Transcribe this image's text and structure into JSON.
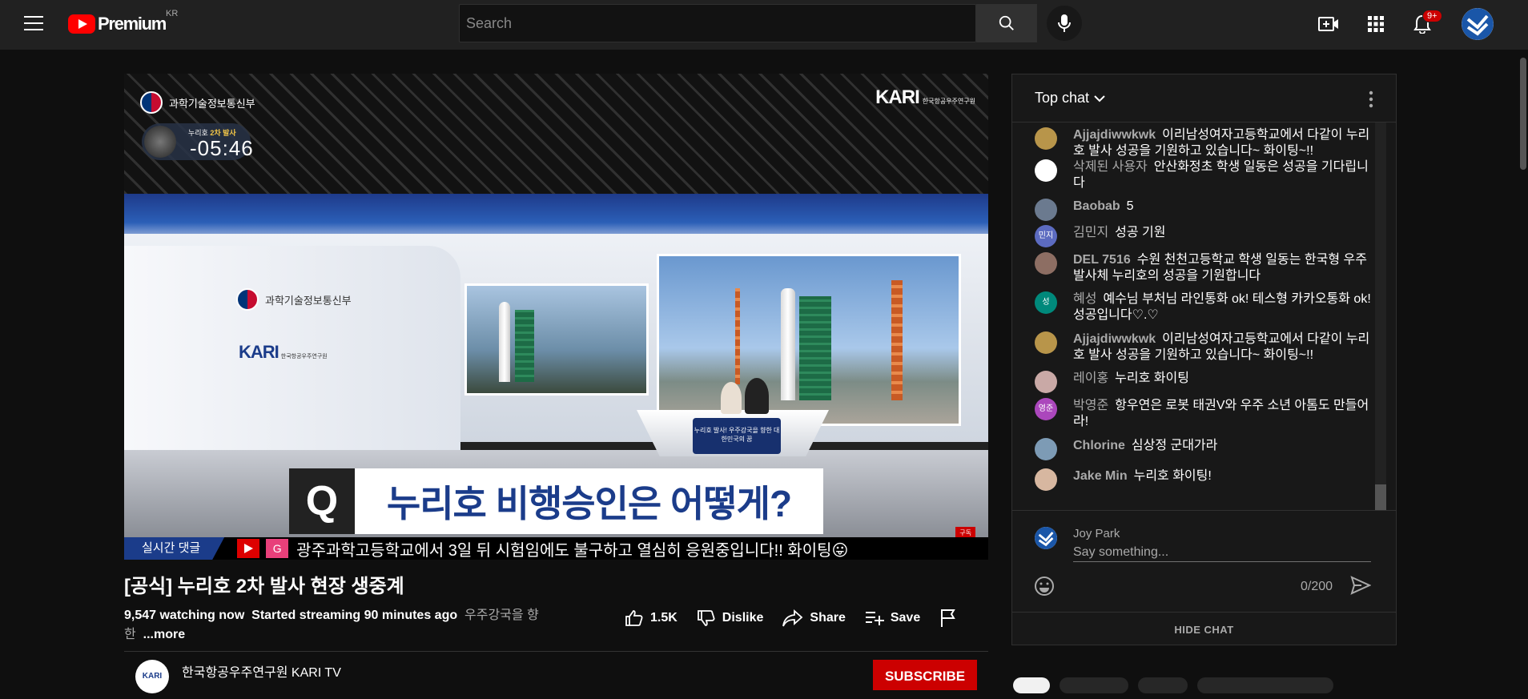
{
  "header": {
    "logo_text": "Premium",
    "region": "KR",
    "search_placeholder": "Search",
    "notification_count": "9+"
  },
  "video": {
    "ministry": "과학기술정보통신부",
    "org_logo": "KARI",
    "org_sub": "한국항공우주연구원",
    "countdown_label_prefix": "누리호",
    "countdown_label_highlight": "2차 발사",
    "countdown_time": "-05:46",
    "question_mark": "Q",
    "question_text": "누리호 비행승인은 어떻게?",
    "ticker_label": "실시간 댓글",
    "ticker_g": "G",
    "ticker_text": "광주과학고등학교에서 3일 뒤 시험임에도 불구하고 열심히 응원중입니다!! 화이팅😛",
    "subscribe_badge": "구독",
    "desk_text": "누리호 발사! 우주강국을 향한 대한민국의 꿈"
  },
  "info": {
    "title": "[공식] 누리호 2차 발사 현장 생중계",
    "watching": "9,547 watching now",
    "started": "Started streaming 90 minutes ago",
    "tags": "우주강국을 향한",
    "more": "...more",
    "likes": "1.5K",
    "dislike": "Dislike",
    "share": "Share",
    "save": "Save",
    "channel": "한국항공우주연구원 KARI TV",
    "channel_avatar": "KARI",
    "subscribe": "SUBSCRIBE"
  },
  "chat": {
    "title": "Top chat",
    "messages": [
      {
        "name": "Ajjajdiwwkwk",
        "text": "이리남성여자고등학교에서 다같이 누리호 발사 성공을 기원하고 있습니다~ 화이팅~!!",
        "avatar": "",
        "color": "#b8954a",
        "bold": true
      },
      {
        "name": "삭제된 사용자",
        "text": "안산화정초 학생 일동은 성공을 기다립니다",
        "avatar": "",
        "color": "#ffffff",
        "bold": false
      },
      {
        "name": "Baobab",
        "text": "5",
        "avatar": "",
        "color": "#6b7a8f",
        "bold": true
      },
      {
        "name": "김민지",
        "text": "성공 기원",
        "avatar": "민지",
        "color": "#5c6bc0",
        "bold": false
      },
      {
        "name": "DEL 7516",
        "text": "수원 천천고등학교 학생 일동는 한국형 우주발사체 누리호의 성공을 기원합니다",
        "avatar": "",
        "color": "#8d6e63",
        "bold": true
      },
      {
        "name": "혜성",
        "text": "예수님 부처님 라인통화 ok! 테스형 카카오통화 ok! 성공입니다♡.♡",
        "avatar": "성",
        "color": "#00897b",
        "bold": false
      },
      {
        "name": "Ajjajdiwwkwk",
        "text": "이리남성여자고등학교에서 다같이 누리호 발사 성공을 기원하고 있습니다~ 화이팅~!!",
        "avatar": "",
        "color": "#b8954a",
        "bold": true
      },
      {
        "name": "레이홍",
        "text": "누리호 화이팅",
        "avatar": "",
        "color": "#c9a9a6",
        "bold": false
      },
      {
        "name": "박영준",
        "text": "항우연은 로봇 태권V와 우주 소년 아톰도 만들어라!",
        "avatar": "영준",
        "color": "#ab47bc",
        "bold": false
      },
      {
        "name": "Chlorine",
        "text": "심상정 군대가라",
        "avatar": "",
        "color": "#7d9bb5",
        "bold": true
      },
      {
        "name": "Jake Min",
        "text": "누리호 화이팅!",
        "avatar": "",
        "color": "#d7b7a0",
        "bold": true
      }
    ],
    "user_name": "Joy Park",
    "input_placeholder": "Say something...",
    "counter": "0/200",
    "hide_chat": "HIDE CHAT"
  }
}
